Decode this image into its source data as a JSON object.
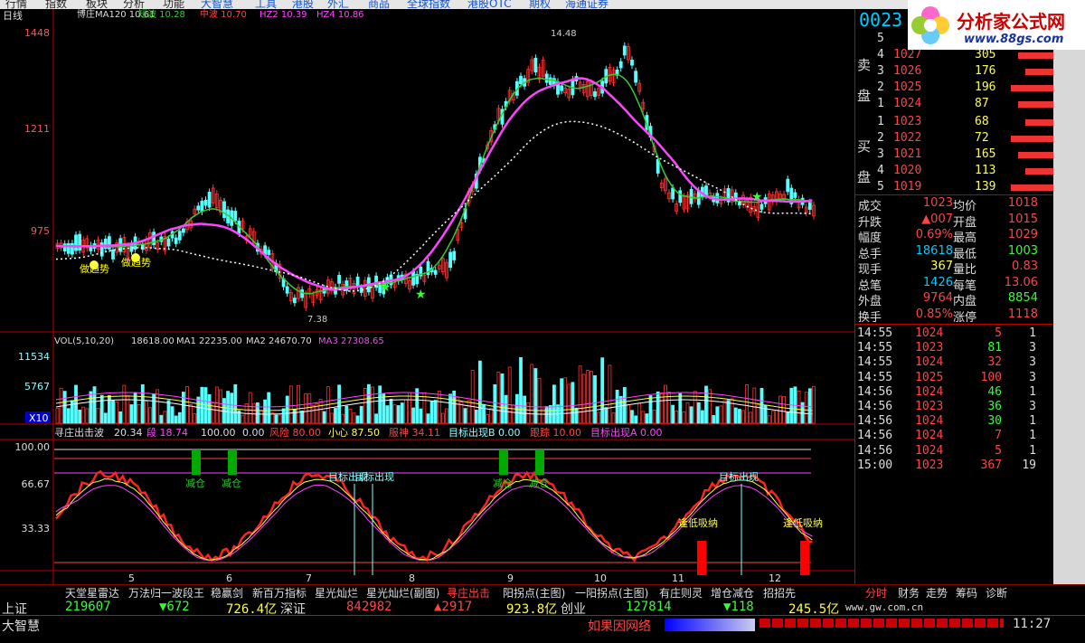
{
  "menu": [
    "行情",
    "指数",
    "板块",
    "分析",
    "功能",
    "大智慧",
    "工具",
    "港股",
    "外汇",
    "商品",
    "全球指数",
    "港股OTC",
    "期权",
    "海通证券"
  ],
  "chart_title": {
    "period": "日线",
    "ma_label": "博庄MA120 10.61",
    "dl": "短波 10.28",
    "zl": "中波 10.70",
    "hz2": "HZ2 10.39",
    "hz4": "HZ4 10.86"
  },
  "price_axis": {
    "top": "1448",
    "mid": "1211",
    "low": "975"
  },
  "price_annotations": {
    "high": "14.48",
    "low": "7.38",
    "signal1": "做趋势",
    "signal2": "做趋势"
  },
  "volume_title": {
    "label": "VOL(5,10,20)",
    "v": "18618.00",
    "ma1": "MA1 22235.00",
    "ma2": "MA2 24670.70",
    "ma3": "MA3 27308.65"
  },
  "volume_axis": {
    "top": "11534",
    "mid": "5767",
    "unit": "X10"
  },
  "indicator_title": {
    "name": "寻庄出击波",
    "v1": "20.34",
    "duan": "段 18.74",
    "v2": "100.00",
    "v3": "0.00",
    "fx": "风险 80.00",
    "xx": "小心 87.50",
    "ss": "服神 34.11",
    "mbb": "目标出现B 0.00",
    "gz": "跟踪 10.00",
    "mba": "目标出现A 0.00"
  },
  "indicator_axis": {
    "a": "100.00",
    "b": "66.67",
    "c": "33.33"
  },
  "indicator_labels": {
    "jc1": "减仓",
    "jc2": "减仓",
    "jc3": "减仓",
    "jc4": "减仓",
    "mb1": "目标出现",
    "mb2": "目标出现",
    "mb3": "目标出现",
    "fd1": "逢低吸纳",
    "fd2": "逢低吸纳"
  },
  "x_axis": [
    "5",
    "6",
    "7",
    "8",
    "9",
    "10",
    "11",
    "12"
  ],
  "stock_code": "0023",
  "order_book": {
    "sell_label": [
      "卖",
      "盘"
    ],
    "buy_label": [
      "买",
      "盘"
    ],
    "asks": [
      {
        "lvl": "5",
        "price": "",
        "vol": ""
      },
      {
        "lvl": "4",
        "price": "1027",
        "vol": "305"
      },
      {
        "lvl": "3",
        "price": "1026",
        "vol": "176"
      },
      {
        "lvl": "2",
        "price": "1025",
        "vol": "196"
      },
      {
        "lvl": "1",
        "price": "1024",
        "vol": "87"
      }
    ],
    "bids": [
      {
        "lvl": "1",
        "price": "1023",
        "vol": "68"
      },
      {
        "lvl": "2",
        "price": "1022",
        "vol": "72"
      },
      {
        "lvl": "3",
        "price": "1021",
        "vol": "165"
      },
      {
        "lvl": "4",
        "price": "1020",
        "vol": "113"
      },
      {
        "lvl": "5",
        "price": "1019",
        "vol": "139"
      }
    ]
  },
  "quote": [
    {
      "l1": "成交",
      "v1": "1023",
      "l2": "均价",
      "v2": "1018"
    },
    {
      "l1": "升跌",
      "v1": "▲007",
      "l2": "开盘",
      "v2": "1015"
    },
    {
      "l1": "幅度",
      "v1": "0.69%",
      "l2": "最高",
      "v2": "1029"
    },
    {
      "l1": "总手",
      "v1": "18618",
      "l2": "最低",
      "v2": "1003"
    },
    {
      "l1": "现手",
      "v1": "367",
      "l2": "量比",
      "v2": "0.83"
    },
    {
      "l1": "总笔",
      "v1": "1426",
      "l2": "每笔",
      "v2": "13.06"
    },
    {
      "l1": "外盘",
      "v1": "9764",
      "l2": "内盘",
      "v2": "8854"
    },
    {
      "l1": "换手",
      "v1": "0.85%",
      "l2": "涨停",
      "v2": "1118"
    }
  ],
  "ticks": [
    {
      "t": "14:55",
      "p": "1024",
      "v": "5",
      "n": "1"
    },
    {
      "t": "14:55",
      "p": "1023",
      "v": "81",
      "n": "3"
    },
    {
      "t": "14:55",
      "p": "1024",
      "v": "32",
      "n": "3"
    },
    {
      "t": "14:55",
      "p": "1025",
      "v": "100",
      "n": "3"
    },
    {
      "t": "14:56",
      "p": "1024",
      "v": "46",
      "n": "1"
    },
    {
      "t": "14:56",
      "p": "1023",
      "v": "36",
      "n": "3"
    },
    {
      "t": "14:56",
      "p": "1024",
      "v": "30",
      "n": "1"
    },
    {
      "t": "14:56",
      "p": "1024",
      "v": "7",
      "n": "1"
    },
    {
      "t": "14:56",
      "p": "1024",
      "v": "5",
      "n": "1"
    },
    {
      "t": "15:00",
      "p": "1023",
      "v": "367",
      "n": "19"
    }
  ],
  "bottom_tabs": [
    "天堂星雷达",
    "万法归一波段王",
    "稳赢剑",
    "新百万指标",
    "星光灿烂",
    "星光灿烂(副图)",
    "寻庄出击",
    "阳拐点(主图)",
    "一阳拐点(主图)",
    "有庄则灵",
    "增仓减仓",
    "招招先"
  ],
  "right_tabs": [
    "分时",
    "财务",
    "走势",
    "筹码",
    "诊断"
  ],
  "status": {
    "sh_label": "上证",
    "sh_val": "219607",
    "sh_chg": "▼672",
    "sh_amt": "726.4亿",
    "sz_label": "深证",
    "sz_val": "842982",
    "sz_chg": "▲2917",
    "sz_amt": "923.8亿",
    "cy_label": "创业",
    "cy_val": "127814",
    "cy_chg": "▼118",
    "cy_amt": "245.5亿",
    "brand": "大智慧",
    "news": "如果因网络",
    "url": "www.gw.com.cn",
    "time": "11:27"
  },
  "logo": {
    "text": "分析家公式网",
    "url": "www.88gs.com"
  }
}
